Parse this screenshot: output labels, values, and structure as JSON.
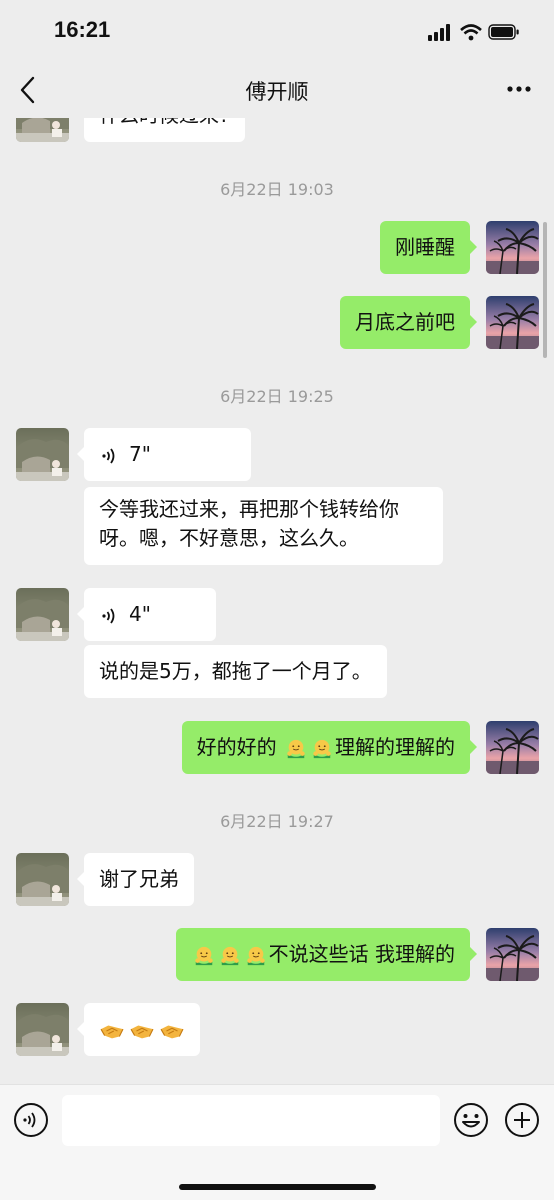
{
  "status_bar": {
    "time": "16:21"
  },
  "nav": {
    "title": "傅开顺"
  },
  "messages": {
    "partial_incoming": "什么时候过来?",
    "ts1": "6月22日 19:03",
    "out1": "刚睡醒",
    "out2": "月底之前吧",
    "ts2": "6月22日 19:25",
    "voice1_duration": "7\"",
    "in_text1": "今等我还过来，再把那个钱转给你呀。嗯，不好意思，这么久。",
    "voice2_duration": "4\"",
    "in_text2": "说的是5万，都拖了一个月了。",
    "out3_before": "好的好的 ",
    "out3_after": "理解的理解的",
    "ts3": "6月22日 19:27",
    "in_text3": "谢了兄弟",
    "out4_text": "不说这些话 我理解的"
  },
  "icons": {
    "signal": "cellular-signal-icon",
    "wifi": "wifi-icon",
    "battery": "battery-icon",
    "back": "chevron-left-icon",
    "more": "more-dots-icon",
    "voice": "voice-wave-icon",
    "hug_emoji": "hug-emoji-icon",
    "handshake_emoji": "handshake-emoji-icon",
    "voice_input": "voice-input-icon",
    "emoji_input": "smiley-icon",
    "plus": "plus-circle-icon"
  },
  "colors": {
    "background": "#ededed",
    "outgoing_bubble": "#95ec69",
    "incoming_bubble": "#ffffff",
    "timestamp": "#9a9a9a"
  },
  "input": {
    "placeholder": ""
  }
}
